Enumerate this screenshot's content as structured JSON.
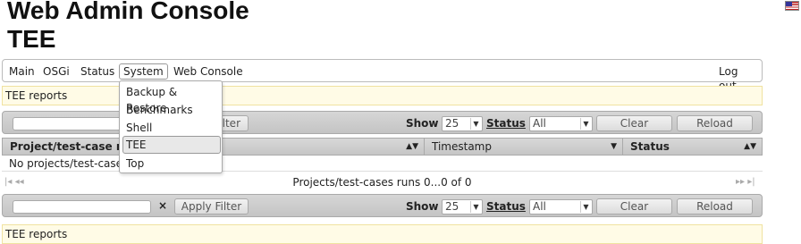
{
  "header": {
    "line1": "Web Admin Console",
    "line2": "TEE"
  },
  "nav": {
    "items": [
      "Main",
      "OSGi",
      "Status",
      "System",
      "Web Console"
    ],
    "logout": "Log out"
  },
  "system_menu": [
    "Backup & Restore",
    "Benchmarks",
    "Shell",
    "TEE",
    "Top"
  ],
  "banner": "TEE reports",
  "toolbar": {
    "clear_x": "×",
    "apply_filter": "Apply Filter",
    "apply_filter_partial": "lter",
    "show_label": "Show",
    "show_value": "25",
    "status_label": "Status",
    "status_value": "All",
    "clear": "Clear",
    "reload": "Reload"
  },
  "table": {
    "columns": [
      "Project/test-case n",
      "Timestamp",
      "Status"
    ],
    "empty": "No projects/test-case"
  },
  "pager": {
    "info": "Projects/test-cases runs 0...0 of 0",
    "first": "|◂ ◂◂",
    "last": "▸▸ ▸|"
  }
}
